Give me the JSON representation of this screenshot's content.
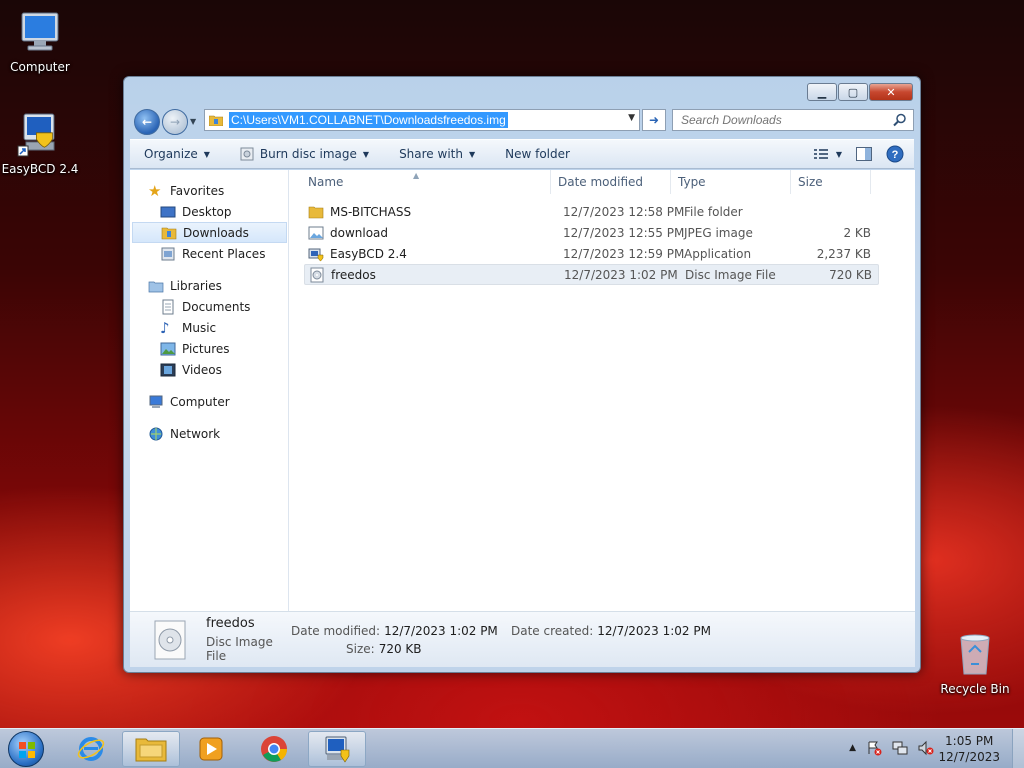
{
  "desktop": {
    "icons": [
      {
        "label": "Computer"
      },
      {
        "label": "EasyBCD 2.4"
      },
      {
        "label": "Recycle Bin"
      }
    ]
  },
  "window": {
    "address_path": "C:\\Users\\VM1.COLLABNET\\Downloadsfreedos.img",
    "search_placeholder": "Search Downloads",
    "toolbar": {
      "organize": "Organize",
      "burn": "Burn disc image",
      "share": "Share with",
      "new_folder": "New folder"
    },
    "nav": {
      "favorites": "Favorites",
      "desktop": "Desktop",
      "downloads": "Downloads",
      "recent": "Recent Places",
      "libraries": "Libraries",
      "documents": "Documents",
      "music": "Music",
      "pictures": "Pictures",
      "videos": "Videos",
      "computer": "Computer",
      "network": "Network"
    },
    "columns": {
      "name": "Name",
      "date": "Date modified",
      "type": "Type",
      "size": "Size"
    },
    "files": [
      {
        "name": "MS-BITCHASS",
        "date": "12/7/2023 12:58 PM",
        "type": "File folder",
        "size": "",
        "icon": "folder-icon"
      },
      {
        "name": "download",
        "date": "12/7/2023 12:55 PM",
        "type": "JPEG image",
        "size": "2 KB",
        "icon": "image-file-icon"
      },
      {
        "name": "EasyBCD 2.4",
        "date": "12/7/2023 12:59 PM",
        "type": "Application",
        "size": "2,237 KB",
        "icon": "application-icon"
      },
      {
        "name": "freedos",
        "date": "12/7/2023 1:02 PM",
        "type": "Disc Image File",
        "size": "720 KB",
        "icon": "disc-image-icon"
      }
    ],
    "details": {
      "name": "freedos",
      "type": "Disc Image File",
      "modified_label": "Date modified:",
      "modified_value": "12/7/2023 1:02 PM",
      "size_label": "Size:",
      "size_value": "720 KB",
      "created_label": "Date created:",
      "created_value": "12/7/2023 1:02 PM"
    }
  },
  "taskbar": {
    "time": "1:05 PM",
    "date": "12/7/2023"
  }
}
